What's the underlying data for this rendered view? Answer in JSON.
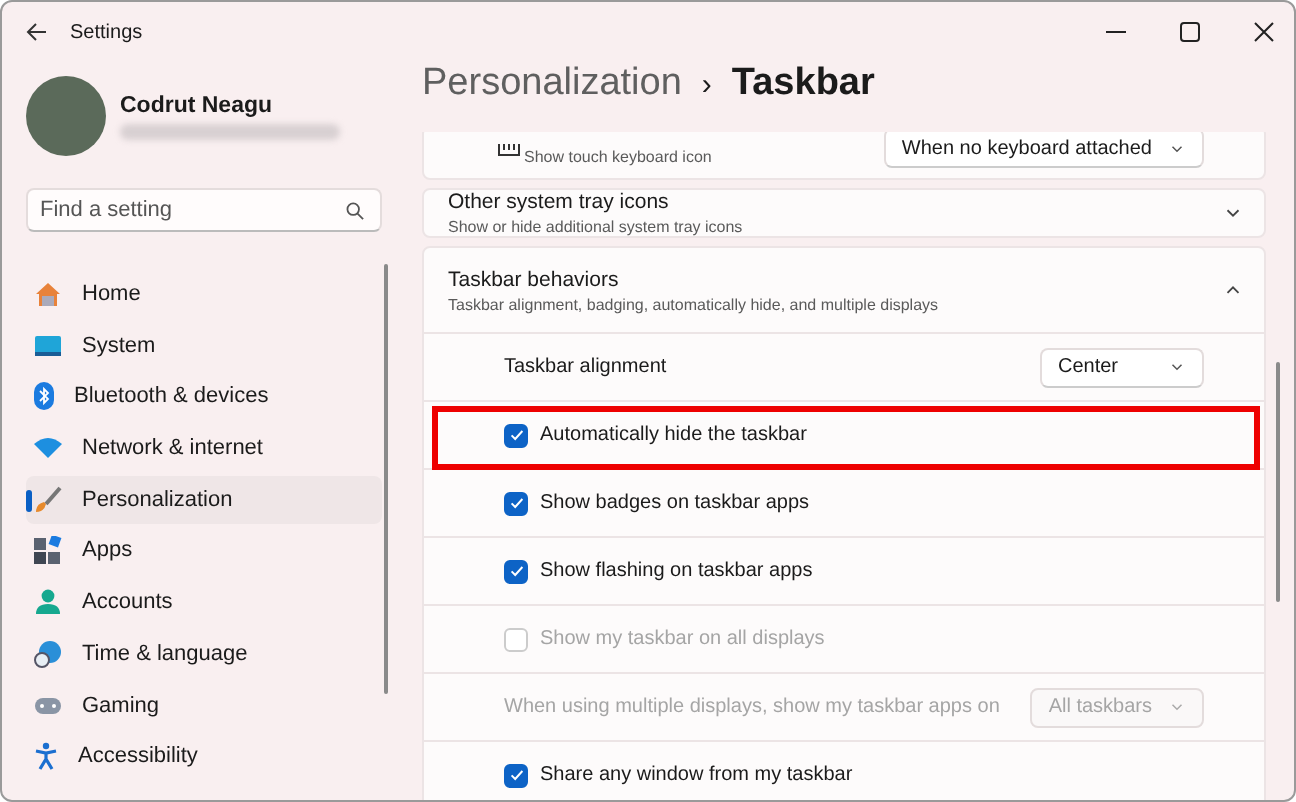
{
  "window": {
    "title": "Settings"
  },
  "account": {
    "name": "Codrut Neagu"
  },
  "search": {
    "placeholder": "Find a setting"
  },
  "sidebar": {
    "items": [
      {
        "label": "Home",
        "selected": false
      },
      {
        "label": "System",
        "selected": false
      },
      {
        "label": "Bluetooth & devices",
        "selected": false
      },
      {
        "label": "Network & internet",
        "selected": false
      },
      {
        "label": "Personalization",
        "selected": true
      },
      {
        "label": "Apps",
        "selected": false
      },
      {
        "label": "Accounts",
        "selected": false
      },
      {
        "label": "Time & language",
        "selected": false
      },
      {
        "label": "Gaming",
        "selected": false
      },
      {
        "label": "Accessibility",
        "selected": false
      }
    ]
  },
  "breadcrumb": {
    "parent": "Personalization",
    "separator": "›",
    "current": "Taskbar"
  },
  "partial_card": {
    "subtitle": "Show touch keyboard icon",
    "dropdown": "When no keyboard attached"
  },
  "tray_card": {
    "title": "Other system tray icons",
    "subtitle": "Show or hide additional system tray icons",
    "expanded": false
  },
  "behaviors": {
    "title": "Taskbar behaviors",
    "subtitle": "Taskbar alignment, badging, automatically hide, and multiple displays",
    "expanded": true,
    "rows": [
      {
        "kind": "dropdown",
        "label": "Taskbar alignment",
        "value": "Center",
        "disabled": false,
        "highlighted": false
      },
      {
        "kind": "checkbox",
        "label": "Automatically hide the taskbar",
        "checked": true,
        "disabled": false,
        "highlighted": true
      },
      {
        "kind": "checkbox",
        "label": "Show badges on taskbar apps",
        "checked": true,
        "disabled": false,
        "highlighted": false
      },
      {
        "kind": "checkbox",
        "label": "Show flashing on taskbar apps",
        "checked": true,
        "disabled": false,
        "highlighted": false
      },
      {
        "kind": "checkbox",
        "label": "Show my taskbar on all displays",
        "checked": false,
        "disabled": true,
        "highlighted": false
      },
      {
        "kind": "dropdown",
        "label": "When using multiple displays, show my taskbar apps on",
        "value": "All taskbars",
        "disabled": true,
        "highlighted": false
      },
      {
        "kind": "checkbox",
        "label": "Share any window from my taskbar",
        "checked": true,
        "disabled": false,
        "highlighted": false
      }
    ]
  }
}
